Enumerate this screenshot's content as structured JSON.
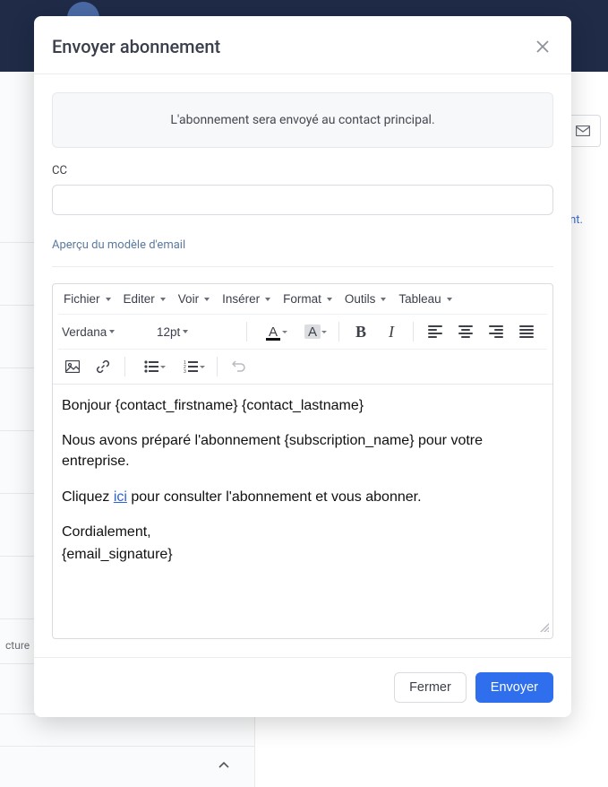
{
  "modal": {
    "title": "Envoyer abonnement",
    "info_banner": "L'abonnement sera envoyé au contact principal.",
    "cc_label": "CC",
    "cc_value": "",
    "preview_link": "Aperçu du modèle d'email",
    "close_label": "Fermer",
    "send_label": "Envoyer"
  },
  "editor_menu": {
    "file": "Fichier",
    "edit": "Editer",
    "view": "Voir",
    "insert": "Insérer",
    "format": "Format",
    "tools": "Outils",
    "table": "Tableau"
  },
  "editor_toolbar": {
    "font_family": "Verdana",
    "font_size": "12pt"
  },
  "email_body": {
    "greeting": "Bonjour {contact_firstname} {contact_lastname}",
    "line1": "Nous avons préparé l'abonnement {subscription_name} pour votre entreprise.",
    "click_prefix": "Cliquez ",
    "click_link": "ici",
    "click_suffix": " pour consulter l'abonnement et vous abonner.",
    "signoff": "Cordialement,",
    "signature": "{email_signature}"
  },
  "background": {
    "link_fragment": "nt.",
    "left_fragment": "cture"
  }
}
